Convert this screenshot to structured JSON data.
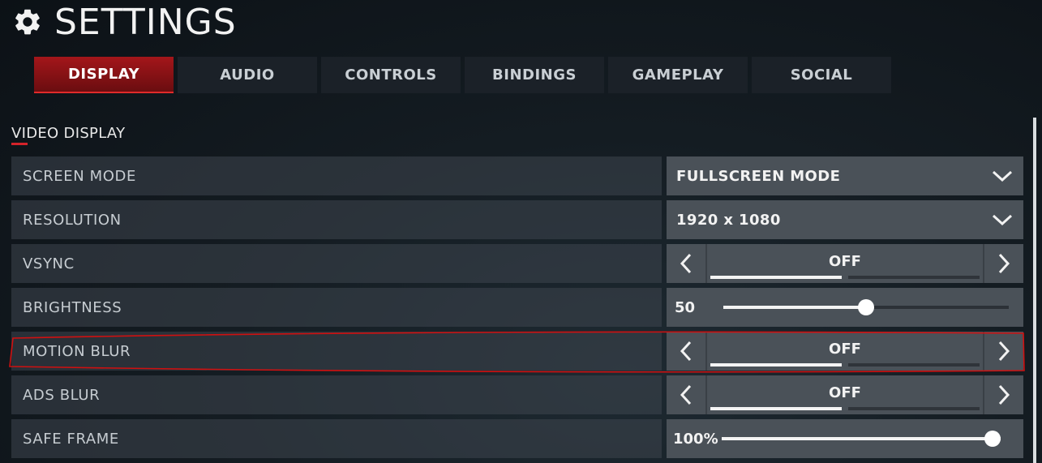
{
  "header": {
    "title": "SETTINGS",
    "icon": "gear-icon"
  },
  "tabs": [
    {
      "label": "DISPLAY",
      "active": true
    },
    {
      "label": "AUDIO",
      "active": false
    },
    {
      "label": "CONTROLS",
      "active": false
    },
    {
      "label": "BINDINGS",
      "active": false
    },
    {
      "label": "GAMEPLAY",
      "active": false
    },
    {
      "label": "SOCIAL",
      "active": false
    }
  ],
  "section": {
    "title": "VIDEO DISPLAY"
  },
  "settings": [
    {
      "label": "SCREEN MODE",
      "control": "dropdown",
      "value": "FULLSCREEN MODE"
    },
    {
      "label": "RESOLUTION",
      "control": "dropdown",
      "value": "1920 x 1080"
    },
    {
      "label": "VSYNC",
      "control": "toggle",
      "value": "OFF"
    },
    {
      "label": "BRIGHTNESS",
      "control": "slider",
      "value": "50",
      "level": 0.5
    },
    {
      "label": "MOTION BLUR",
      "control": "toggle",
      "value": "OFF"
    },
    {
      "label": "ADS BLUR",
      "control": "toggle",
      "value": "OFF"
    },
    {
      "label": "SAFE FRAME",
      "control": "slider",
      "value": "100%",
      "level": 1.0
    }
  ],
  "colors": {
    "accent": "#b0151a",
    "annotation": "#d01010",
    "panel": "#4a5158"
  }
}
